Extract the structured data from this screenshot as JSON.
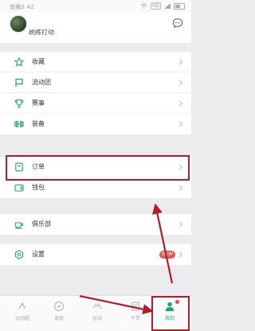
{
  "status": {
    "time": "傍晚5:42",
    "hd": "HD"
  },
  "profile": {
    "username": "刷练打动"
  },
  "menu": {
    "group1": [
      {
        "name": "favorites",
        "label": "收藏"
      },
      {
        "name": "running-group",
        "label": "流动团"
      },
      {
        "name": "events",
        "label": "赛事"
      },
      {
        "name": "equipment",
        "label": "装备"
      }
    ],
    "group2": [
      {
        "name": "orders",
        "label": "订单"
      },
      {
        "name": "wallet",
        "label": "钱包"
      }
    ],
    "group3": [
      {
        "name": "club",
        "label": "俱乐部"
      }
    ],
    "group4": [
      {
        "name": "settings",
        "label": "设置",
        "badge": "NEW"
      }
    ]
  },
  "tabs": [
    {
      "name": "moments",
      "label": "运动圈"
    },
    {
      "name": "discover",
      "label": "发现"
    },
    {
      "name": "sport",
      "label": "运动"
    },
    {
      "name": "plan",
      "label": "干货"
    },
    {
      "name": "mine",
      "label": "我的",
      "active": true
    }
  ],
  "colors": {
    "accent": "#1ea868",
    "highlight": "#b01d2b",
    "badge": "#e45757"
  }
}
